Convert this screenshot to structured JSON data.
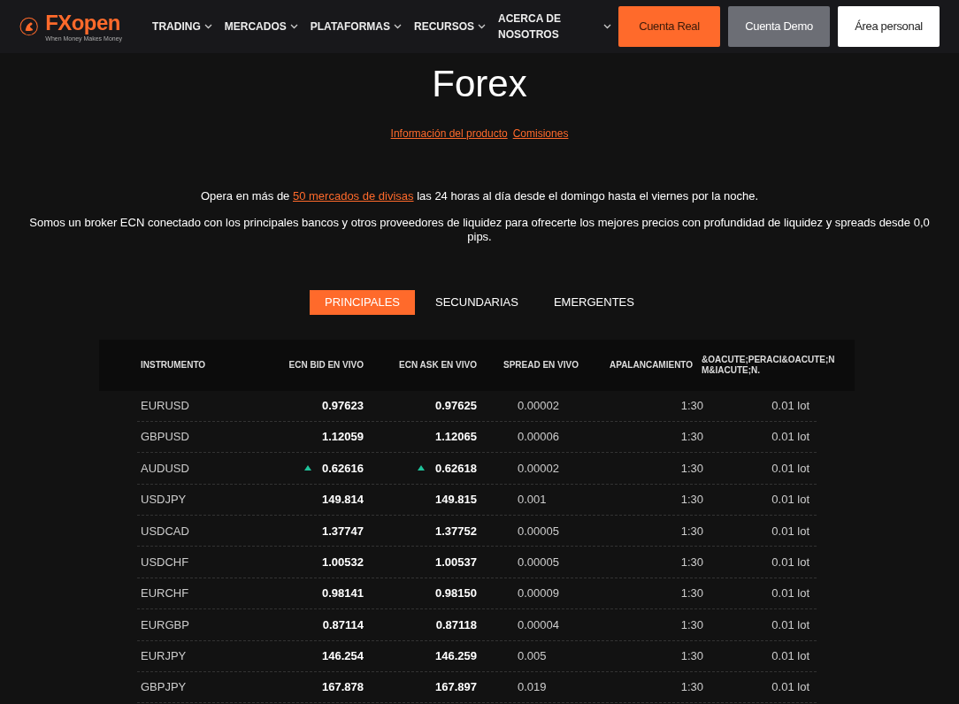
{
  "nav": {
    "logo": "FXopen",
    "tagline": "When Money Makes Money",
    "items": [
      {
        "label": "TRADING"
      },
      {
        "label": "MERCADOS"
      },
      {
        "label": "PLATAFORMAS"
      },
      {
        "label": "RECURSOS"
      },
      {
        "label": "ACERCA DE NOSOTROS"
      }
    ],
    "buttons": [
      {
        "label": "Cuenta Real",
        "kind": "primary"
      },
      {
        "label": "Cuenta Demo",
        "kind": "secondary"
      },
      {
        "label": "Área personal",
        "kind": "light"
      }
    ]
  },
  "title": "Forex",
  "links": [
    "Información del producto",
    "Comisiones"
  ],
  "intro": {
    "before": "Opera en más de ",
    "link": "50 mercados de divisas",
    "after": " las 24 horas al día desde el domingo hasta el viernes por la noche."
  },
  "description": "Somos un broker ECN conectado con los principales bancos y otros proveedores de liquidez para ofrecerte los mejores precios con profundidad de liquidez y spreads desde 0,0 pips.",
  "tabs": [
    {
      "label": "PRINCIPALES",
      "selected": true
    },
    {
      "label": "SECUNDARIAS",
      "selected": false
    },
    {
      "label": "EMERGENTES",
      "selected": false
    }
  ],
  "table": {
    "columns": [
      "INSTRUMENTO",
      "ECN BID EN VIVO",
      "ECN ASK EN VIVO",
      "SPREAD EN VIVO",
      "APALANCAMIENTO",
      "&OACUTE;PERACI&OACUTE;N M&IACUTE;N."
    ],
    "rows": [
      {
        "instrument": "EURUSD",
        "bid": "0.97623",
        "bid_up": false,
        "ask": "0.97625",
        "ask_up": false,
        "spread": "0.00002",
        "leverage": "1:30",
        "min": "0.01 lot"
      },
      {
        "instrument": "GBPUSD",
        "bid": "1.12059",
        "bid_up": false,
        "ask": "1.12065",
        "ask_up": false,
        "spread": "0.00006",
        "leverage": "1:30",
        "min": "0.01 lot"
      },
      {
        "instrument": "AUDUSD",
        "bid": "0.62616",
        "bid_up": true,
        "ask": "0.62618",
        "ask_up": true,
        "spread": "0.00002",
        "leverage": "1:30",
        "min": "0.01 lot"
      },
      {
        "instrument": "USDJPY",
        "bid": "149.814",
        "bid_up": false,
        "ask": "149.815",
        "ask_up": false,
        "spread": "0.001",
        "leverage": "1:30",
        "min": "0.01 lot"
      },
      {
        "instrument": "USDCAD",
        "bid": "1.37747",
        "bid_up": false,
        "ask": "1.37752",
        "ask_up": false,
        "spread": "0.00005",
        "leverage": "1:30",
        "min": "0.01 lot"
      },
      {
        "instrument": "USDCHF",
        "bid": "1.00532",
        "bid_up": false,
        "ask": "1.00537",
        "ask_up": false,
        "spread": "0.00005",
        "leverage": "1:30",
        "min": "0.01 lot"
      },
      {
        "instrument": "EURCHF",
        "bid": "0.98141",
        "bid_up": false,
        "ask": "0.98150",
        "ask_up": false,
        "spread": "0.00009",
        "leverage": "1:30",
        "min": "0.01 lot"
      },
      {
        "instrument": "EURGBP",
        "bid": "0.87114",
        "bid_up": false,
        "ask": "0.87118",
        "ask_up": false,
        "spread": "0.00004",
        "leverage": "1:30",
        "min": "0.01 lot"
      },
      {
        "instrument": "EURJPY",
        "bid": "146.254",
        "bid_up": false,
        "ask": "146.259",
        "ask_up": false,
        "spread": "0.005",
        "leverage": "1:30",
        "min": "0.01 lot"
      },
      {
        "instrument": "GBPJPY",
        "bid": "167.878",
        "bid_up": false,
        "ask": "167.897",
        "ask_up": false,
        "spread": "0.019",
        "leverage": "1:30",
        "min": "0.01 lot"
      }
    ]
  }
}
